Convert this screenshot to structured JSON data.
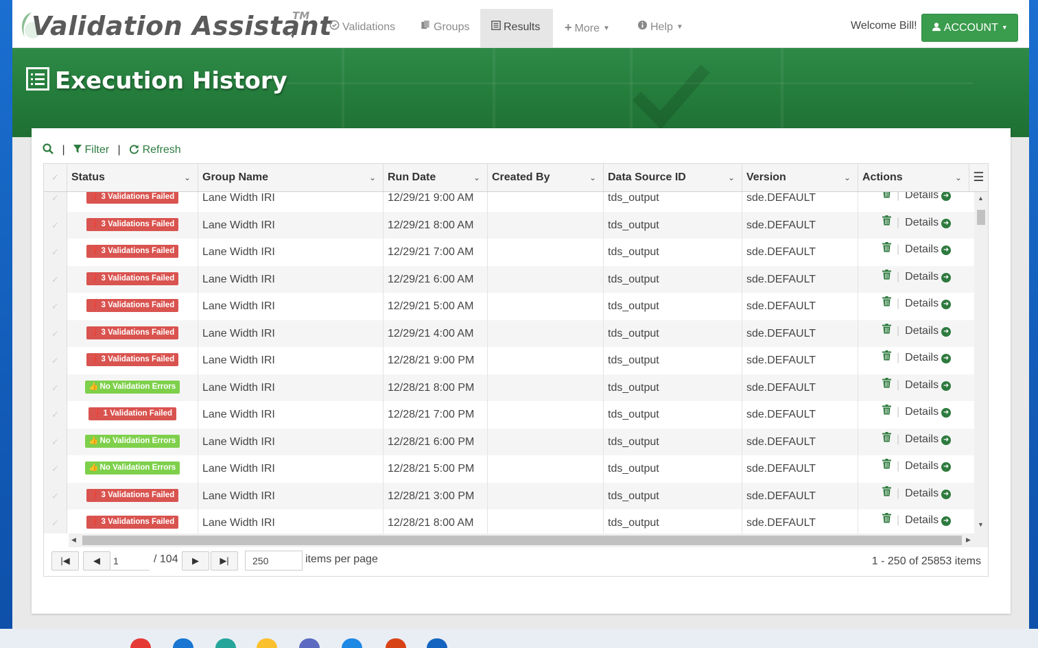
{
  "brand": {
    "name": "Validation Assistant",
    "tm": "TM"
  },
  "nav": {
    "items": [
      {
        "label": "Validations",
        "icon": "check-circle-icon"
      },
      {
        "label": "Groups",
        "icon": "files-icon"
      },
      {
        "label": "Results",
        "icon": "list-icon",
        "active": true
      },
      {
        "label": "More",
        "icon": "plus-icon"
      },
      {
        "label": "Help",
        "icon": "info-circle-icon"
      }
    ],
    "welcome": "Welcome Bill!",
    "account_label": "ACCOUNT"
  },
  "page": {
    "title": "Execution History"
  },
  "toolbar": {
    "filter": "Filter",
    "refresh": "Refresh"
  },
  "grid": {
    "columns": [
      "Status",
      "Group Name",
      "Run Date",
      "Created By",
      "Data Source ID",
      "Version",
      "Actions"
    ],
    "details_label": "Details",
    "rows": [
      {
        "status": "3 Validations Failed",
        "status_type": "fail",
        "group": "Lane Width IRI",
        "run_date": "12/29/21 9:00 AM",
        "created_by": "",
        "datasource": "tds_output",
        "version": "sde.DEFAULT"
      },
      {
        "status": "3 Validations Failed",
        "status_type": "fail",
        "group": "Lane Width IRI",
        "run_date": "12/29/21 8:00 AM",
        "created_by": "",
        "datasource": "tds_output",
        "version": "sde.DEFAULT"
      },
      {
        "status": "3 Validations Failed",
        "status_type": "fail",
        "group": "Lane Width IRI",
        "run_date": "12/29/21 7:00 AM",
        "created_by": "",
        "datasource": "tds_output",
        "version": "sde.DEFAULT"
      },
      {
        "status": "3 Validations Failed",
        "status_type": "fail",
        "group": "Lane Width IRI",
        "run_date": "12/29/21 6:00 AM",
        "created_by": "",
        "datasource": "tds_output",
        "version": "sde.DEFAULT"
      },
      {
        "status": "3 Validations Failed",
        "status_type": "fail",
        "group": "Lane Width IRI",
        "run_date": "12/29/21 5:00 AM",
        "created_by": "",
        "datasource": "tds_output",
        "version": "sde.DEFAULT"
      },
      {
        "status": "3 Validations Failed",
        "status_type": "fail",
        "group": "Lane Width IRI",
        "run_date": "12/29/21 4:00 AM",
        "created_by": "",
        "datasource": "tds_output",
        "version": "sde.DEFAULT"
      },
      {
        "status": "3 Validations Failed",
        "status_type": "fail",
        "group": "Lane Width IRI",
        "run_date": "12/28/21 9:00 PM",
        "created_by": "",
        "datasource": "tds_output",
        "version": "sde.DEFAULT"
      },
      {
        "status": "No Validation Errors",
        "status_type": "ok",
        "group": "Lane Width IRI",
        "run_date": "12/28/21 8:00 PM",
        "created_by": "",
        "datasource": "tds_output",
        "version": "sde.DEFAULT"
      },
      {
        "status": "1 Validation Failed",
        "status_type": "fail",
        "group": "Lane Width IRI",
        "run_date": "12/28/21 7:00 PM",
        "created_by": "",
        "datasource": "tds_output",
        "version": "sde.DEFAULT"
      },
      {
        "status": "No Validation Errors",
        "status_type": "ok",
        "group": "Lane Width IRI",
        "run_date": "12/28/21 6:00 PM",
        "created_by": "",
        "datasource": "tds_output",
        "version": "sde.DEFAULT"
      },
      {
        "status": "No Validation Errors",
        "status_type": "ok",
        "group": "Lane Width IRI",
        "run_date": "12/28/21 5:00 PM",
        "created_by": "",
        "datasource": "tds_output",
        "version": "sde.DEFAULT"
      },
      {
        "status": "3 Validations Failed",
        "status_type": "fail",
        "group": "Lane Width IRI",
        "run_date": "12/28/21 3:00 PM",
        "created_by": "",
        "datasource": "tds_output",
        "version": "sde.DEFAULT"
      },
      {
        "status": "3 Validations Failed",
        "status_type": "fail",
        "group": "Lane Width IRI",
        "run_date": "12/28/21 8:00 AM",
        "created_by": "",
        "datasource": "tds_output",
        "version": "sde.DEFAULT"
      }
    ]
  },
  "pager": {
    "current_page": "1",
    "total_pages": "/ 104",
    "per_page": "250",
    "per_page_label": "items per page",
    "summary": "1 - 250 of 25853 items"
  },
  "colors": {
    "brand_green": "#2d7a3e",
    "fail": "#d9534f",
    "ok": "#7ed04b",
    "account": "#3a9c4d"
  }
}
